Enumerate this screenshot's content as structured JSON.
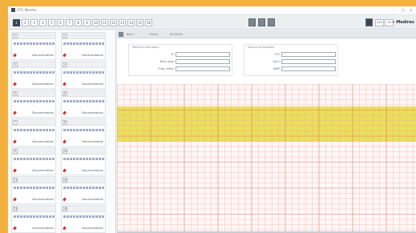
{
  "window": {
    "title": "CTG Monitor"
  },
  "titlebar_controls": [
    "–",
    "□",
    "×"
  ],
  "beds": [
    "1",
    "2",
    "3",
    "4",
    "5",
    "6",
    "7",
    "8",
    "9",
    "10",
    "11",
    "12",
    "13",
    "14",
    "15",
    "16"
  ],
  "active_bed": "1",
  "toolbar": {
    "monitor_buttons": [
      "24h",
      "1h"
    ],
    "brand": "Medirex"
  },
  "sidebar": {
    "tiles": [
      {
        "num": "1",
        "label": "Documentation"
      },
      {
        "num": "2",
        "label": "Documentation"
      },
      {
        "num": "3",
        "label": "Documentation"
      },
      {
        "num": "4",
        "label": "Documentation"
      },
      {
        "num": "5",
        "label": "Documentation"
      },
      {
        "num": "6",
        "label": "Documentation"
      },
      {
        "num": "7",
        "label": "Documentation"
      },
      {
        "num": "8",
        "label": "Documentation"
      },
      {
        "num": "9",
        "label": "Documentation"
      },
      {
        "num": "10",
        "label": "Documentation"
      },
      {
        "num": "11",
        "label": "Documentation"
      },
      {
        "num": "12",
        "label": "Documentation"
      },
      {
        "num": "13",
        "label": "Documentation"
      },
      {
        "num": "14",
        "label": "Documentation"
      }
    ]
  },
  "main": {
    "header": {
      "name": "Bed 1",
      "status": "Online",
      "time": "00:00:00"
    },
    "patient_panel": {
      "title": "Patient Information",
      "fields": [
        {
          "label": "ID",
          "value": ""
        },
        {
          "label": "Birth date",
          "value": ""
        },
        {
          "label": "Preg. Week",
          "value": ""
        }
      ]
    },
    "status_panel": {
      "title": "Device Information",
      "fields": [
        {
          "label": "CTG",
          "value": ""
        },
        {
          "label": "SpO₂",
          "value": ""
        },
        {
          "label": "NIBP",
          "value": ""
        }
      ]
    }
  },
  "colors": {
    "background": "#f2b13e",
    "grid_line": "#f0a8a0",
    "highlight_band": "#eadf5a"
  }
}
